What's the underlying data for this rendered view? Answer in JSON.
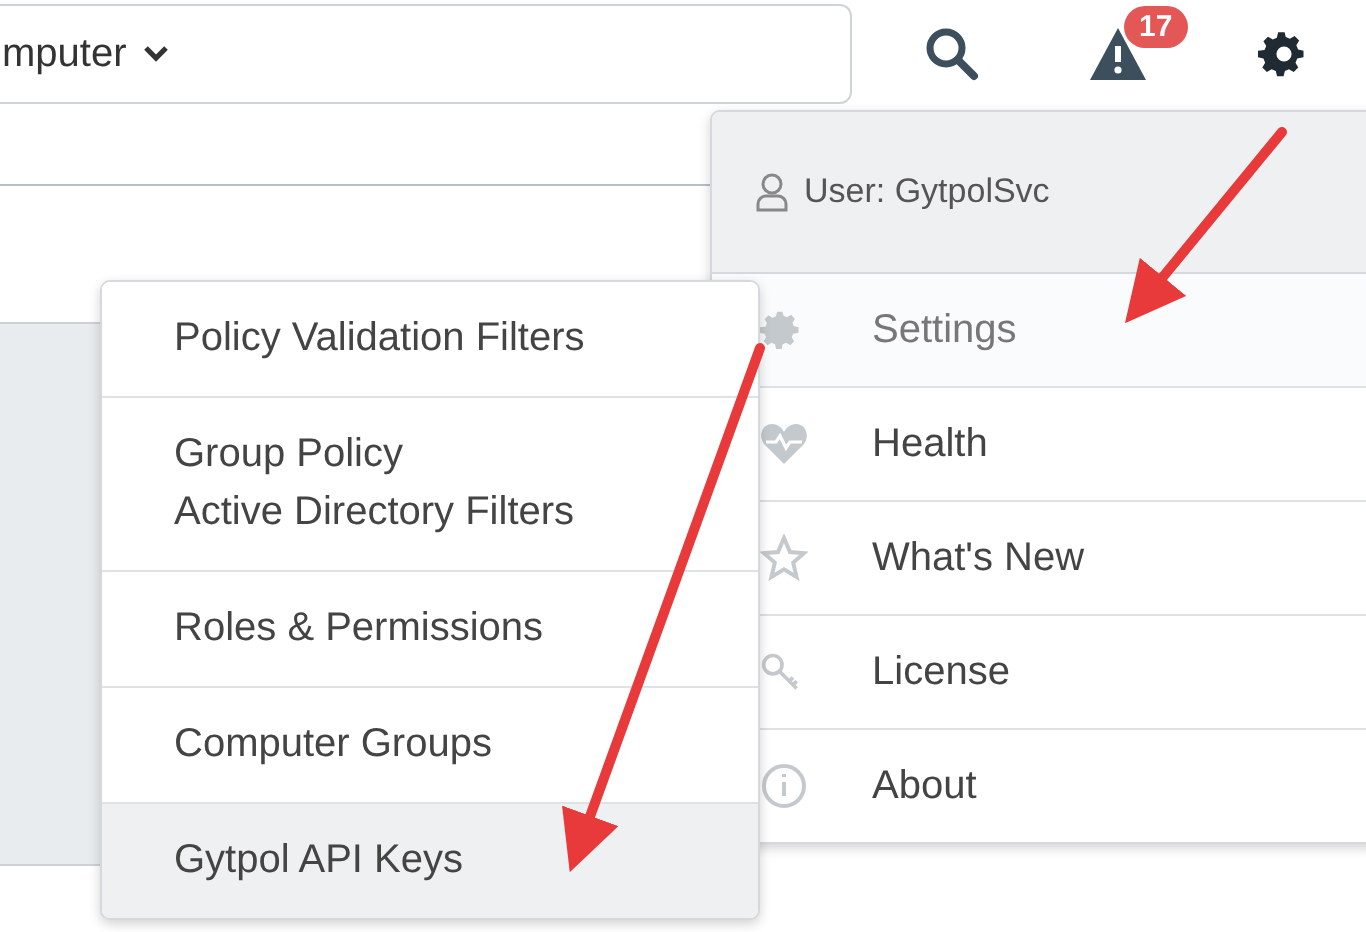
{
  "filter_field": {
    "value": "mputer"
  },
  "toolbar": {
    "alert_count": "17"
  },
  "user_menu": {
    "user": "User: GytpolSvc",
    "items": [
      {
        "label": "Settings",
        "selected": true
      },
      {
        "label": "Health",
        "selected": false
      },
      {
        "label": "What's New",
        "selected": false
      },
      {
        "label": "License",
        "selected": false
      },
      {
        "label": "About",
        "selected": false
      }
    ]
  },
  "settings_submenu": {
    "items": [
      {
        "label": "Policy Validation Filters",
        "selected": false
      },
      {
        "label": "Group Policy\nActive Directory Filters",
        "selected": false
      },
      {
        "label": "Roles & Permissions",
        "selected": false
      },
      {
        "label": "Computer Groups",
        "selected": false
      },
      {
        "label": "Gytpol API Keys",
        "selected": true
      }
    ]
  }
}
